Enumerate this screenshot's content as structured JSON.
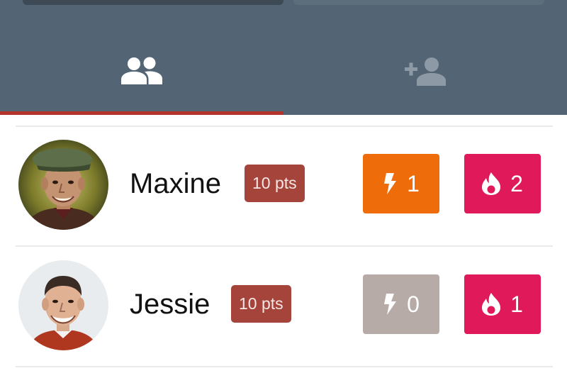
{
  "colors": {
    "header_bg": "#536574",
    "tab_active_icon": "#ffffff",
    "tab_inactive_icon": "#8d9aa5",
    "tab_indicator": "#b2332b",
    "pts_badge": "#a5443b",
    "bolt_active": "#ee6c0a",
    "bolt_inactive": "#b6aba6",
    "flame": "#e0195a"
  },
  "tabs": [
    {
      "icon": "group-icon",
      "active": true
    },
    {
      "icon": "add-person-icon",
      "active": false
    }
  ],
  "players": [
    {
      "name": "Maxine",
      "points": "10 pts",
      "bolt_count": "1",
      "bolt_active": true,
      "flame_count": "2",
      "avatar": "avatar-photo-man-in-cap"
    },
    {
      "name": "Jessie",
      "points": "10 pts",
      "bolt_count": "0",
      "bolt_active": false,
      "flame_count": "1",
      "avatar": "avatar-photo-smiling-man"
    }
  ]
}
